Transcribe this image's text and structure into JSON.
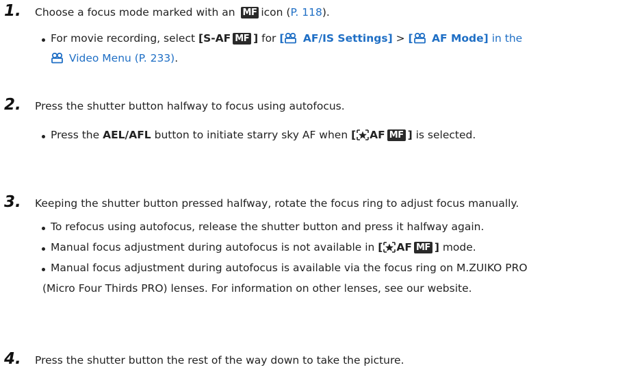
{
  "steps": [
    {
      "number": "1.",
      "lead": {
        "before": "Choose a focus mode marked with an",
        "badge": "MF",
        "after": "icon (",
        "link": "P. 118",
        "end": ")."
      },
      "bullet": {
        "t1": "For movie recording, select ",
        "sel_open": "[S-AF",
        "sel_badge": "MF",
        "sel_close": "]",
        "t2": " for ",
        "l1_open": "[",
        "l1_text": " AF/IS Settings]",
        "sep": " > ",
        "l2_open": "[",
        "l2_text": " AF Mode]",
        "l2_tail": " in the",
        "line2": " Video Menu (P. 233)",
        "line2_end": "."
      }
    },
    {
      "number": "2.",
      "lead": "Press the shutter button halfway to focus using autofocus.",
      "bullet": {
        "t1": "Press the ",
        "key": "AEL/AFL",
        "t2": " button to initiate starry sky AF when ",
        "sel_open": "[",
        "sel_af": "AF",
        "sel_badge": "MF",
        "sel_close": "]",
        "t3": " is selected."
      }
    },
    {
      "number": "3.",
      "lead": "Keeping the shutter button pressed halfway, rotate the focus ring to adjust focus manually.",
      "bullets": {
        "b1": "To refocus using autofocus, release the shutter button and press it halfway again.",
        "b2_t1": "Manual focus adjustment during autofocus is not available in ",
        "b2_open": "[",
        "b2_af": "AF",
        "b2_badge": "MF",
        "b2_close": "]",
        "b2_t2": " mode.",
        "b3_line1": "Manual focus adjustment during autofocus is available via the focus ring on M.ZUIKO PRO",
        "b3_line2": "(Micro Four Thirds PRO) lenses. For information on other lenses, see our website."
      }
    },
    {
      "number": "4.",
      "lead": "Press the shutter button the rest of the way down to take the picture."
    }
  ],
  "colors": {
    "link": "#1f6fc5",
    "text": "#222222",
    "badge": "#2a2a2a"
  },
  "icons": [
    "mf-badge-icon",
    "movie-camera-icon",
    "starry-sky-icon"
  ]
}
